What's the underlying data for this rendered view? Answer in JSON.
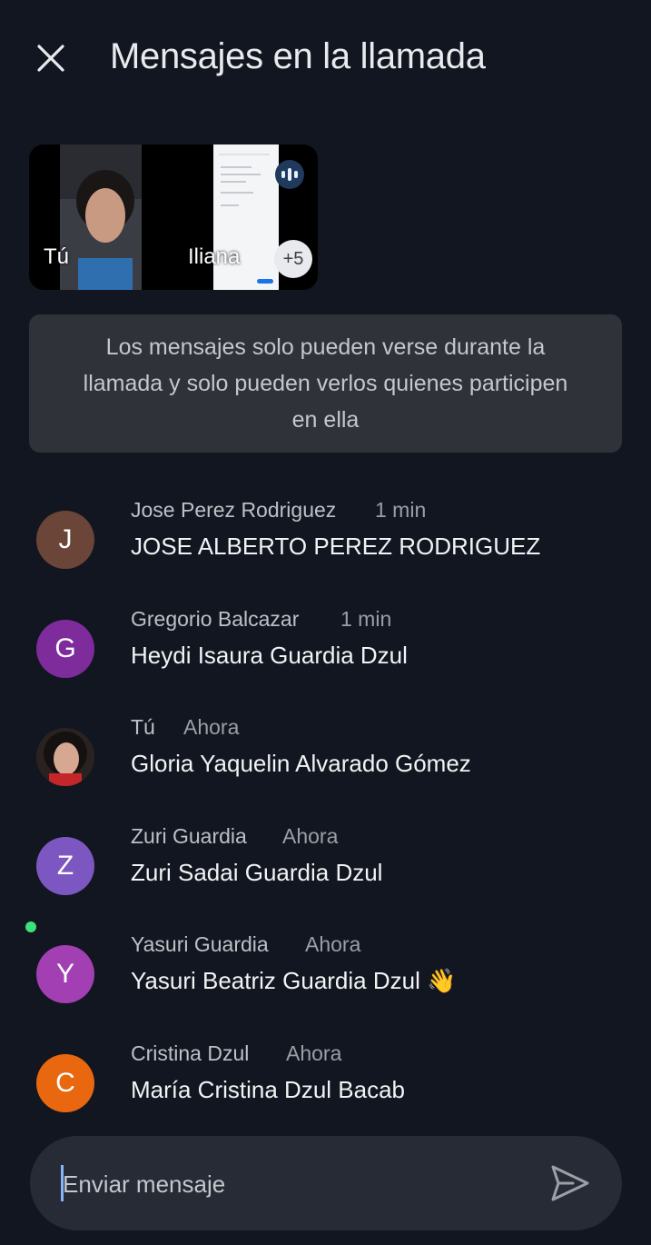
{
  "header": {
    "title": "Mensajes en la llamada",
    "close_icon": "close-icon"
  },
  "participants": {
    "self_label": "Tú",
    "presenter_label": "Iliana",
    "more_count": "+5",
    "audio_icon": "audio-level-icon"
  },
  "notice": "Los mensajes solo pueden verse durante la llamada y solo pueden verlos quienes participen en ella",
  "messages": [
    {
      "initial": "J",
      "avatar_color": "#6b4537",
      "sender": "Jose Perez Rodriguez",
      "time": "1 min",
      "text": "JOSE ALBERTO PEREZ RODRIGUEZ"
    },
    {
      "initial": "G",
      "avatar_color": "#7e2b9c",
      "sender": "Gregorio Balcazar",
      "time": "1 min",
      "text": "Heydi Isaura Guardia Dzul"
    },
    {
      "initial": "",
      "avatar_color": "#2a2220",
      "sender": "Tú",
      "time": "Ahora",
      "text": "Gloria Yaquelin Alvarado Gómez"
    },
    {
      "initial": "Z",
      "avatar_color": "#7d57c1",
      "sender": "Zuri Guardia",
      "time": "Ahora",
      "text": "Zuri Sadai Guardia Dzul"
    },
    {
      "initial": "Y",
      "avatar_color": "#a13fb3",
      "sender": "Yasuri Guardia",
      "time": "Ahora",
      "text": "Yasuri Beatriz Guardia Dzul 👋"
    },
    {
      "initial": "C",
      "avatar_color": "#e8670f",
      "sender": "Cristina Dzul",
      "time": "Ahora",
      "text": "María Cristina Dzul Bacab"
    }
  ],
  "composer": {
    "placeholder": "Enviar mensaje",
    "send_icon": "send-icon"
  },
  "colors": {
    "background": "#121620",
    "notice_bg": "#2f3238",
    "composer_bg": "#262b35",
    "presence": "#3ee07a"
  }
}
